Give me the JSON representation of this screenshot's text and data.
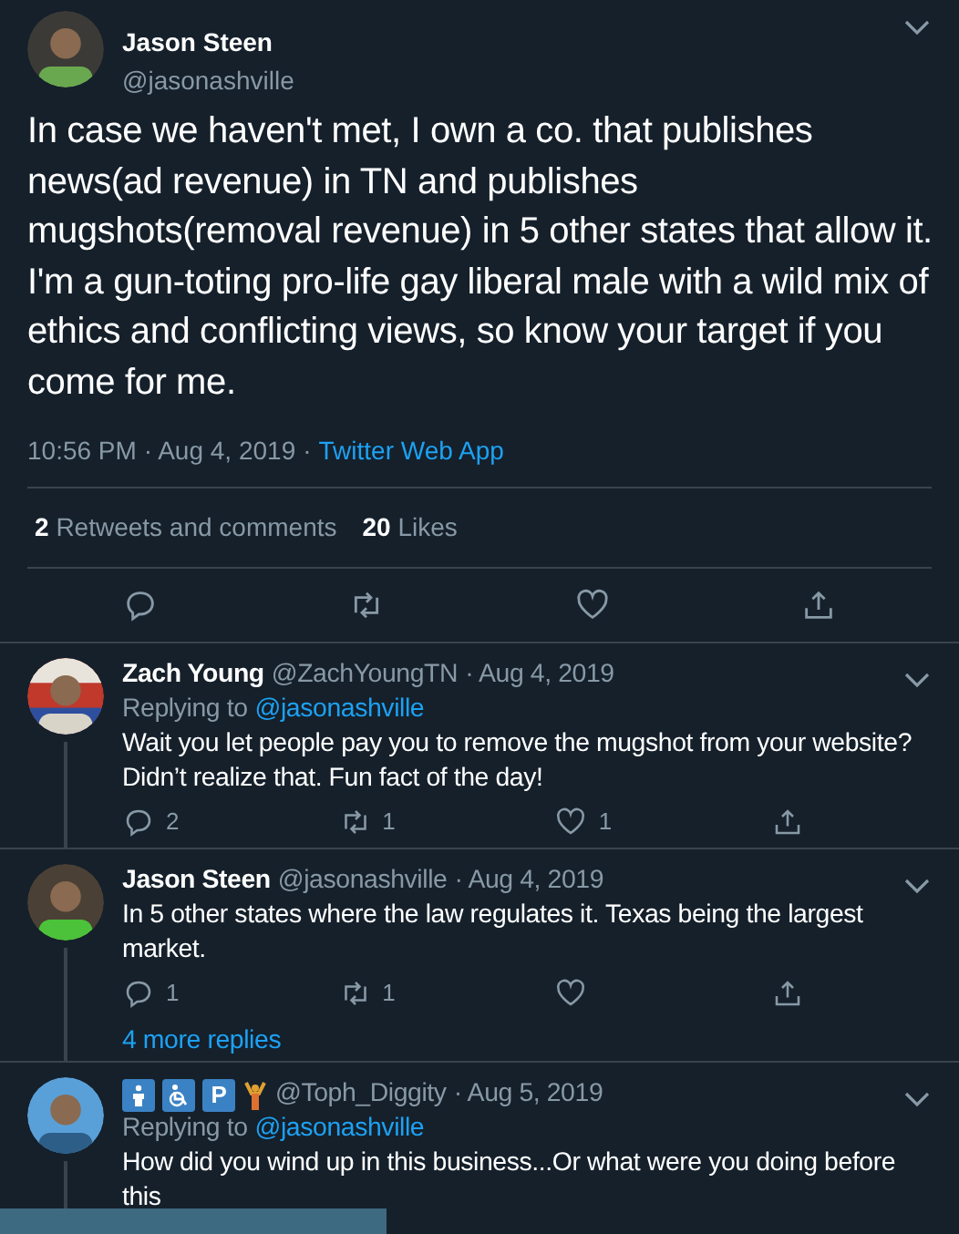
{
  "tweet": {
    "name": "Jason Steen",
    "handle": "@jasonashville",
    "text": "In case we haven't met, I own a co. that publishes news(ad revenue) in TN and publishes mugshots(removal revenue) in 5 other states that allow it. I'm a gun-toting pro-life gay liberal male with a wild mix of ethics and conflicting views, so know your target if you come for me.",
    "time": "10:56 PM · Aug 4, 2019",
    "sep": "·",
    "source": "Twitter Web App",
    "stats": [
      {
        "count": "2",
        "label": "Retweets and comments"
      },
      {
        "count": "20",
        "label": "Likes"
      }
    ]
  },
  "replies": [
    {
      "name": "Zach Young",
      "handle": "@ZachYoungTN",
      "date": "· Aug 4, 2019",
      "replying_label": "Replying to",
      "replying_to": "@jasonashville",
      "text": "Wait you let people pay you to remove the mugshot from your website? Didn’t realize that. Fun fact of the day!",
      "counts": {
        "reply": "2",
        "retweet": "1",
        "like": "1"
      }
    },
    {
      "name": "Jason Steen",
      "handle": "@jasonashville",
      "date": "· Aug 4, 2019",
      "text": "In 5 other states where the law regulates it. Texas being the largest market.",
      "counts": {
        "reply": "1",
        "retweet": "1"
      },
      "more": "4 more replies"
    },
    {
      "badges": [
        {
          "kind": "man"
        },
        {
          "kind": "wheelchair"
        },
        {
          "kind": "parking",
          "label": "P"
        },
        {
          "kind": "lifter"
        }
      ],
      "handle": "@Toph_Diggity",
      "date": "· Aug 5, 2019",
      "replying_label": "Replying to",
      "replying_to": "@jasonashville",
      "text": "How did you wind up in this business...Or what were you doing before this"
    }
  ]
}
